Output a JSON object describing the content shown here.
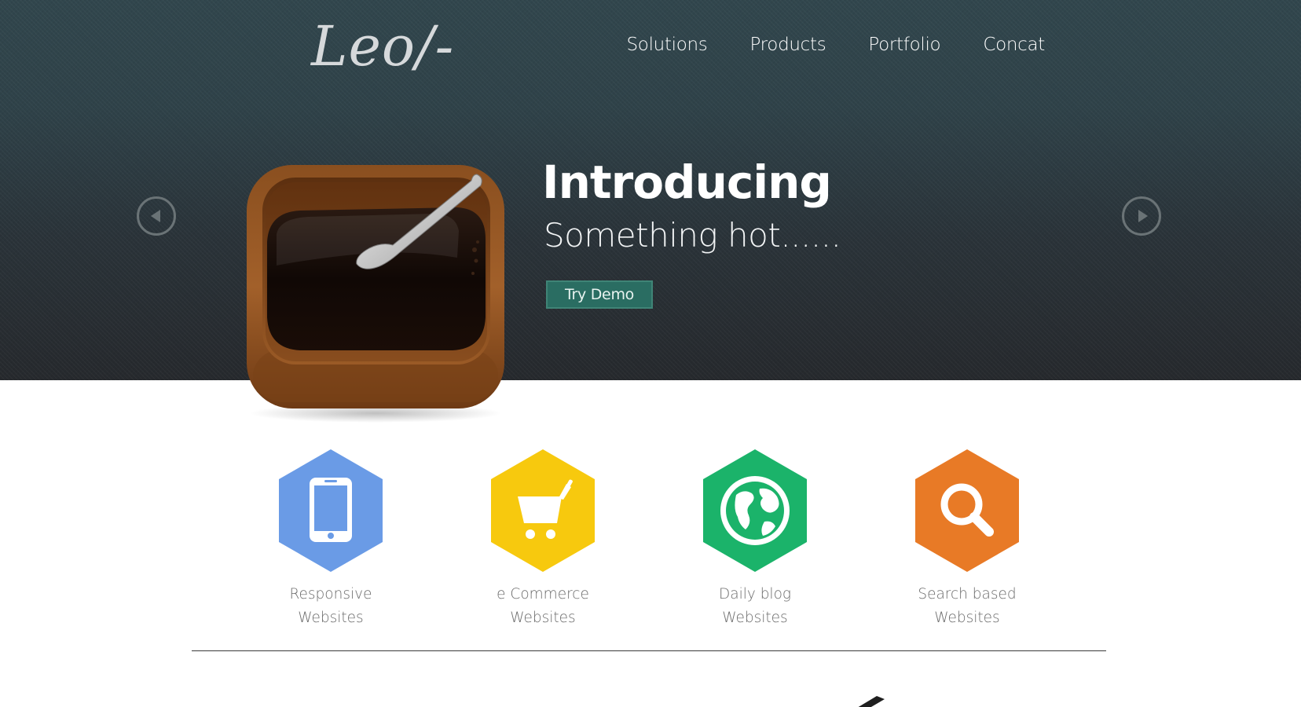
{
  "brand": {
    "logo_text": "Leo/-"
  },
  "nav": {
    "items": [
      {
        "label": "Solutions"
      },
      {
        "label": "Products"
      },
      {
        "label": "Portfolio"
      },
      {
        "label": "Concat"
      }
    ]
  },
  "hero": {
    "headline": "Introducing",
    "subline": "Something hot......",
    "cta_label": "Try Demo",
    "prev_icon": "prev-arrow-icon",
    "next_icon": "next-arrow-icon",
    "image_icon": "coffee-box-icon"
  },
  "services": [
    {
      "icon": "smartphone-icon",
      "color": "#6a9be6",
      "line1": "Responsive",
      "line2": "Websites"
    },
    {
      "icon": "shopping-cart-icon",
      "color": "#f7c90e",
      "line1": "e Commerce",
      "line2": "Websites"
    },
    {
      "icon": "globe-icon",
      "color": "#1bb36a",
      "line1": "Daily blog",
      "line2": "Websites"
    },
    {
      "icon": "search-icon",
      "color": "#e87a26",
      "line1": "Search based",
      "line2": "Websites"
    }
  ],
  "colors": {
    "hero_top": "#31464d",
    "hero_bottom": "#26292d",
    "cta_bg": "#2a6d62"
  }
}
